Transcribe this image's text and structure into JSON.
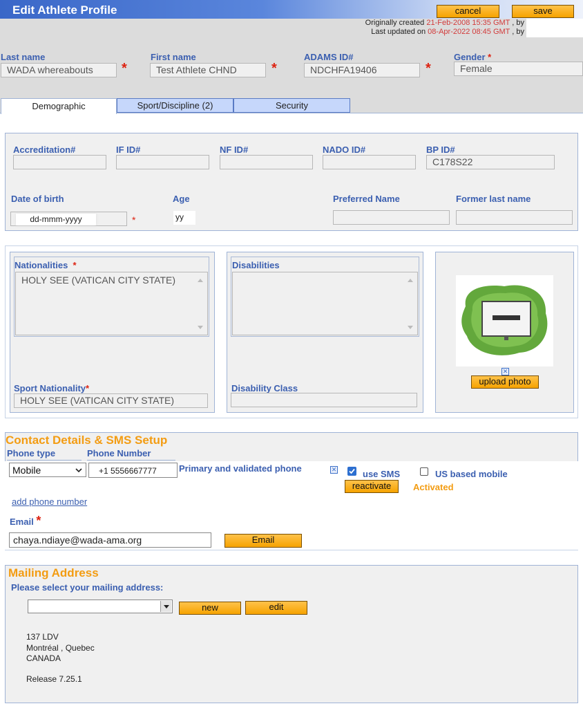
{
  "header": {
    "title": "Edit Athlete Profile",
    "cancel_label": "cancel",
    "save_label": "save",
    "created_label": "Originally created",
    "created_value": "21-Feb-2008 15:35 GMT",
    "updated_label": "Last updated on",
    "updated_value": "08-Apr-2022 08:45 GMT",
    "by_text": ", by"
  },
  "identity": {
    "last_name_label": "Last name",
    "last_name_value": "WADA whereabouts",
    "first_name_label": "First name",
    "first_name_value": "Test Athlete CHND",
    "adams_label": "ADAMS ID#",
    "adams_value": "NDCHFA19406",
    "gender_label": "Gender",
    "gender_value": "Female",
    "required_mark": "*"
  },
  "tabs": [
    "Demographic",
    "Sport/Discipline (2)",
    "Security"
  ],
  "demographic": {
    "accreditation_label": "Accreditation#",
    "accreditation_value": "",
    "ifid_label": "IF ID#",
    "ifid_value": "",
    "nfid_label": "NF ID#",
    "nfid_value": "",
    "nadoid_label": "NADO ID#",
    "nadoid_value": "",
    "bpid_label": "BP ID#",
    "bpid_value": "C178S22",
    "dob_label": "Date of birth",
    "dob_value": "dd-mmm-yyyy",
    "age_label": "Age",
    "age_value": "yy",
    "preferred_name_label": "Preferred Name",
    "former_last_name_label": "Former last name"
  },
  "nationality": {
    "nationalities_label": "Nationalities",
    "nationalities_value": "HOLY SEE (VATICAN CITY STATE)",
    "disabilities_label": "Disabilities",
    "sport_nationality_label": "Sport Nationality",
    "sport_nationality_value": "HOLY SEE (VATICAN CITY STATE)",
    "disability_class_label": "Disability Class",
    "upload_photo_label": "upload photo",
    "remove_photo_icon": "close-icon"
  },
  "contact": {
    "heading": "Contact Details & SMS Setup",
    "phone_type_label": "Phone type",
    "phone_number_label": "Phone Number",
    "phone_type_value": "Mobile",
    "phone_number_value": "+1 5556667777",
    "primary_label": "Primary and validated phone",
    "use_sms_label": "use SMS",
    "us_mobile_label": "US based mobile",
    "reactivate_label": "reactivate",
    "activated_label": "Activated",
    "add_phone_label": "add phone number",
    "email_label": "Email",
    "email_value": "chaya.ndiaye@wada-ama.org",
    "email_button_label": "Email"
  },
  "mailing": {
    "heading": "Mailing Address",
    "select_prompt": "Please select your mailing address:",
    "new_label": "new",
    "edit_label": "edit",
    "address_line1": "137 LDV",
    "address_line2": "Montréal , Quebec",
    "address_line3": "CANADA",
    "release": "Release 7.25.1"
  },
  "colors": {
    "accent_orange": "#f39c12",
    "label_blue": "#3b5fb0",
    "required_red": "#dd2211",
    "date_red": "#d23a3a"
  }
}
